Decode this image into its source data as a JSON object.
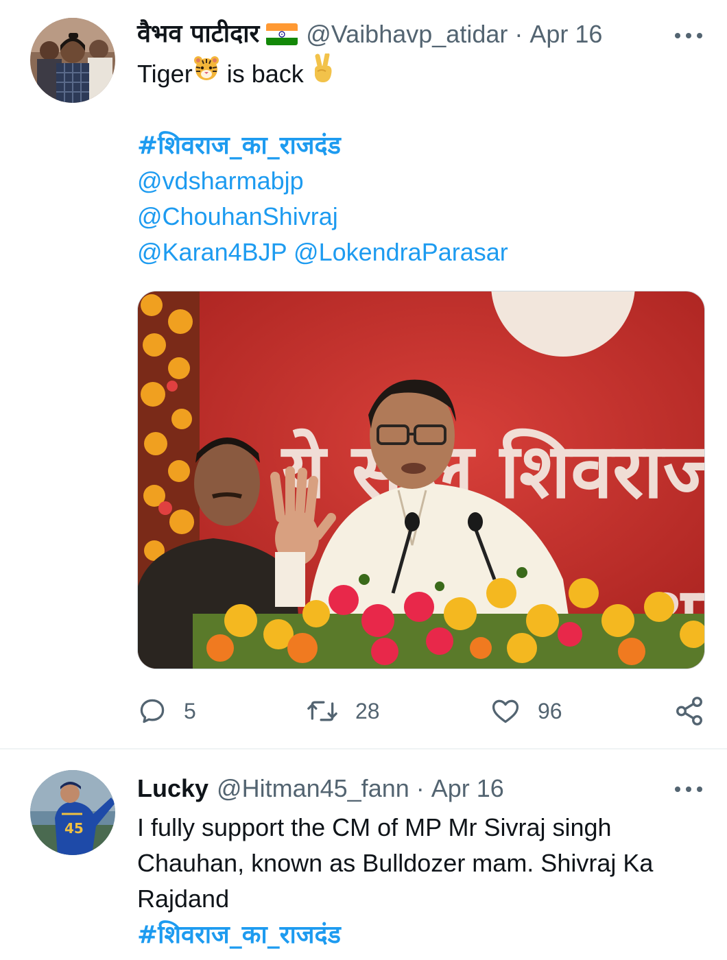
{
  "tweets": [
    {
      "author_name": "वैभव पाटीदार",
      "handle": "@Vaibhavp_atidar",
      "separator": "·",
      "date": "Apr 16",
      "text_part1": "Tiger",
      "text_part2": " is back ",
      "emoji_1": "tiger-face-emoji",
      "emoji_2": "victory-hand-emoji",
      "hashtag": "#शिवराज_का_राजदंड",
      "mentions": [
        "@vdsharmabjp",
        "@ChouhanShivraj",
        "@Karan4BJP",
        "@LokendraParasar"
      ],
      "image_banner_text": "ये साल शिवराज",
      "image_banner_text_right": "श्रा",
      "actions": {
        "replies": "5",
        "retweets": "28",
        "likes": "96"
      }
    },
    {
      "author_name": "Lucky",
      "handle": "@Hitman45_fann",
      "separator": "·",
      "date": "Apr 16",
      "text_lines": [
        "I fully support the CM of MP Mr Sivraj singh",
        "Chauhan, known as Bulldozer mam. Shivraj Ka",
        "Rajdand"
      ],
      "hashtag": "#शिवराज_का_राजदंड",
      "jersey_text": "45"
    }
  ],
  "colors": {
    "link": "#1d9bf0",
    "secondary_text": "#536471",
    "primary_text": "#0f1419",
    "divider": "#eff3f4",
    "image_backdrop": "#c9302c"
  }
}
